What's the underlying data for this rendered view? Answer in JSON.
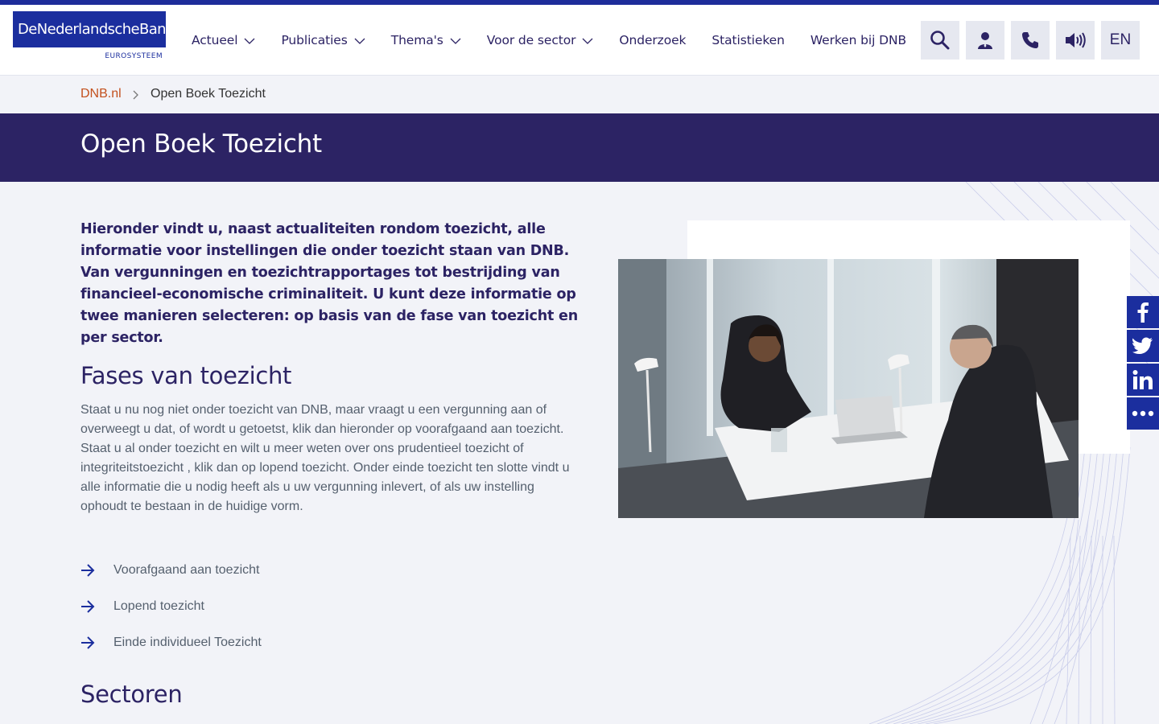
{
  "brand": {
    "logo_text": "DeNederlandscheBank",
    "logo_sub": "EUROSYSTEEM",
    "primary": "#1b2e9e",
    "dark": "#2c2364",
    "accent": "#c3501d"
  },
  "nav": {
    "items": [
      {
        "label": "Actueel",
        "dropdown": true
      },
      {
        "label": "Publicaties",
        "dropdown": true
      },
      {
        "label": "Thema's",
        "dropdown": true
      },
      {
        "label": "Voor de sector",
        "dropdown": true
      },
      {
        "label": "Onderzoek",
        "dropdown": false
      },
      {
        "label": "Statistieken",
        "dropdown": false
      },
      {
        "label": "Werken bij DNB",
        "dropdown": false
      }
    ],
    "icons": [
      "search-icon",
      "user-icon",
      "phone-icon",
      "speaker-icon"
    ],
    "lang_label": "EN"
  },
  "breadcrumb": {
    "home": "DNB.nl",
    "current": "Open Boek Toezicht"
  },
  "page": {
    "title": "Open Boek Toezicht",
    "intro": "Hieronder vindt u, naast actualiteiten rondom toezicht, alle informatie voor instellingen die onder toezicht staan van DNB. Van vergunningen en toezichtrapportages tot bestrijding van financieel-economische criminaliteit. U kunt deze informatie op twee manieren selecteren: op basis van de fase van toezicht en per sector.",
    "fases_heading": "Fases van toezicht",
    "fases_text": "Staat u nu nog niet onder toezicht van DNB, maar vraagt u een vergunning aan of overweegt u dat, of wordt u getoetst, klik dan hieronder op voorafgaand aan toezicht. Staat u al onder toezicht en wilt u meer weten over ons prudentieel toezicht of integriteitstoezicht , klik dan op lopend toezicht. Onder einde toezicht ten slotte vindt u alle informatie die u nodig heeft als u uw vergunning inlevert, of als uw instelling ophoudt te bestaan in de huidige vorm.",
    "links": [
      "Voorafgaand aan toezicht",
      "Lopend toezicht",
      "Einde individueel Toezicht"
    ],
    "sectoren_heading": "Sectoren"
  },
  "share": [
    "facebook-icon",
    "twitter-icon",
    "linkedin-icon",
    "more-icon"
  ]
}
